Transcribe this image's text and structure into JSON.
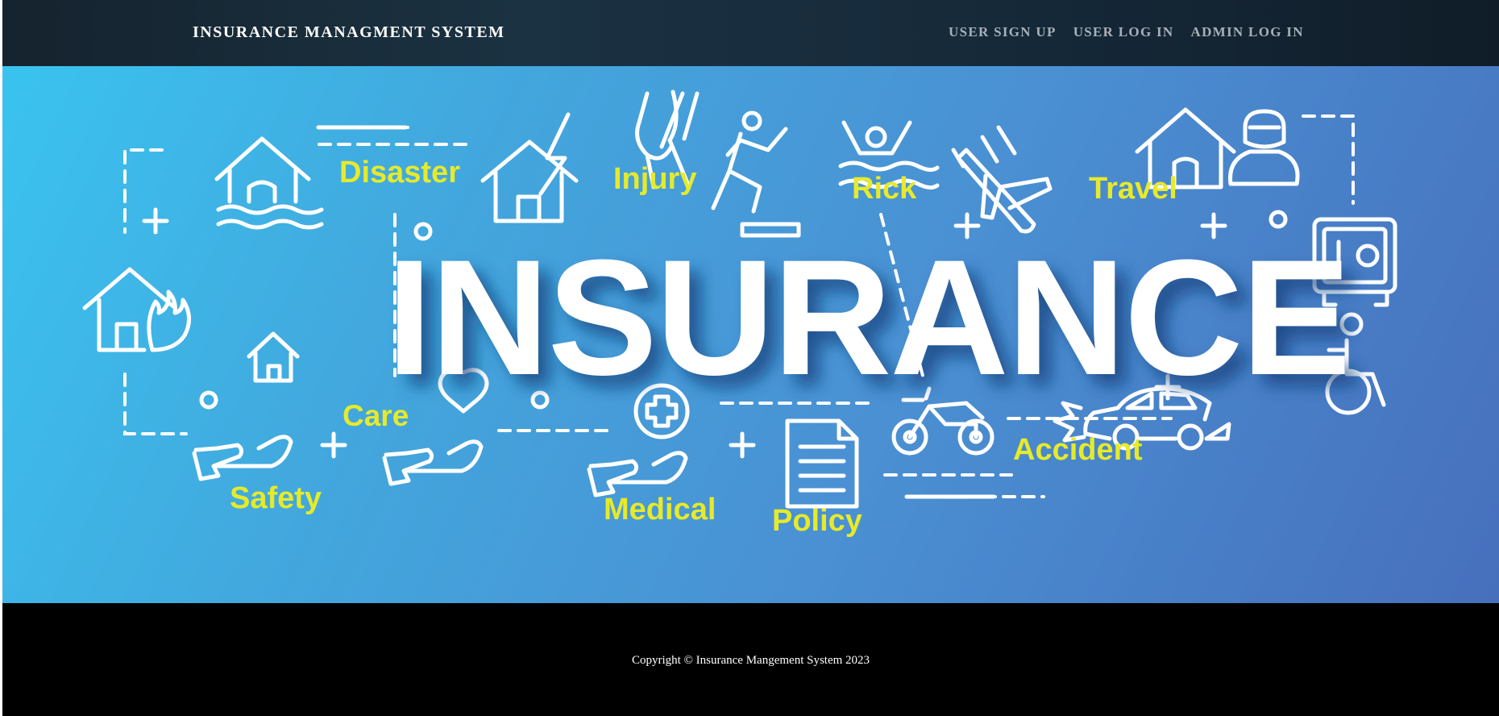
{
  "navbar": {
    "brand": "INSURANCE MANAGMENT SYSTEM",
    "links": [
      "USER SIGN UP",
      "USER LOG IN",
      "ADMIN LOG IN"
    ]
  },
  "hero": {
    "headline": "INSURANCE",
    "keywords": {
      "disaster": "Disaster",
      "injury": "Injury",
      "rick": "Rick",
      "travel": "Travel",
      "care": "Care",
      "safety": "Safety",
      "medical": "Medical",
      "policy": "Policy",
      "accident": "Accident"
    },
    "colors": {
      "keyword": "#e6ea2a",
      "background_start": "#3ac3ef",
      "background_end": "#476fbc"
    },
    "icons": [
      "flooded-house-icon",
      "lightning-house-icon",
      "knee-injury-icon",
      "slipping-person-icon",
      "drowning-person-icon",
      "falling-plane-icon",
      "house-icon",
      "burglar-icon",
      "safe-icon",
      "burning-house-icon",
      "hand-house-icon",
      "hand-heart-icon",
      "hand-medical-cross-icon",
      "document-icon",
      "motorcycle-icon",
      "car-crash-icon",
      "wheelchair-icon"
    ]
  },
  "footer": {
    "copyright": "Copyright © Insurance Mangement System 2023"
  }
}
